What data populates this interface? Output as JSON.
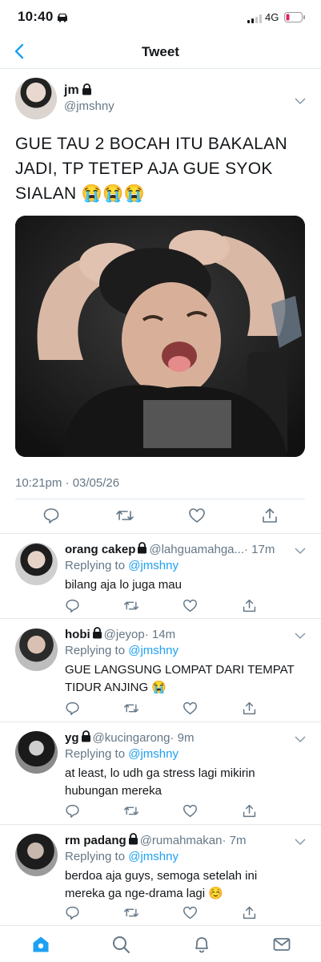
{
  "status_bar": {
    "time": "10:40",
    "network": "4G"
  },
  "nav": {
    "title": "Tweet"
  },
  "tweet": {
    "name": "jm",
    "handle": "@jmshny",
    "text": "GUE TAU 2 BOCAH ITU BAKALAN JADI, TP TETEP AJA GUE SYOK SIALAN 😭😭😭",
    "timestamp": "10:21pm · 03/05/26"
  },
  "replies": [
    {
      "name": "orang cakep",
      "handle": "@lahguamahga...",
      "time": "· 17m",
      "replying_prefix": "Replying to ",
      "replying_to": "@jmshny",
      "text": "bilang aja lo juga mau"
    },
    {
      "name": "hobi",
      "handle": "@jeyop",
      "time": "· 14m",
      "replying_prefix": "Replying to ",
      "replying_to": "@jmshny",
      "text": "GUE LANGSUNG LOMPAT DARI TEMPAT TIDUR ANJING 😭"
    },
    {
      "name": "yg",
      "handle": "@kucingarong",
      "time": "· 9m",
      "replying_prefix": "Replying to ",
      "replying_to": "@jmshny",
      "text": "at least, lo udh ga stress lagi mikirin hubungan mereka"
    },
    {
      "name": "rm padang",
      "handle": "@rumahmakan",
      "time": "· 7m",
      "replying_prefix": "Replying to ",
      "replying_to": "@jmshny",
      "text": "berdoa aja guys, semoga setelah ini mereka ga nge-drama lagi ☺️"
    }
  ],
  "colors": {
    "accent": "#1da1f2",
    "secondary_text": "#657786",
    "divider": "#e1e8ed",
    "battery_low": "#e0245e"
  },
  "icons": [
    "back-chevron-icon",
    "lock-icon",
    "chevron-down-icon",
    "reply-icon",
    "retweet-icon",
    "like-icon",
    "share-icon",
    "home-icon",
    "search-icon",
    "notifications-icon",
    "messages-icon"
  ]
}
